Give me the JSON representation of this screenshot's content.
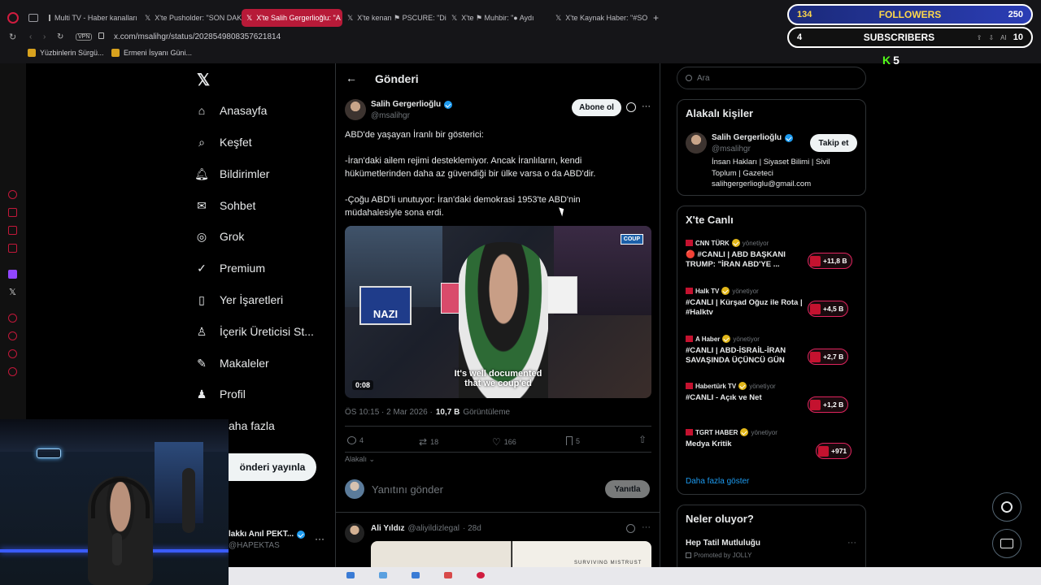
{
  "browser": {
    "tabs": [
      {
        "label": "Multi TV - Haber kanalları"
      },
      {
        "label": "X'te Pusholder: \"SON DAK"
      },
      {
        "label": "X'te Salih Gergerlioğlu: \"A"
      },
      {
        "label": "X'te kenan ⚑ PSCURE: \"Dili"
      },
      {
        "label": "X'te ⚑ Muhbir: \"● Aydı"
      },
      {
        "label": "X'te Kaynak Haber: \"#SON"
      }
    ],
    "url": "x.com/msalihgr/status/2028549808357621814",
    "vpn_label": "VPN",
    "bookmarks": [
      "Yüzbinlerin Sürgü...",
      "Ermeni İsyanı Güni..."
    ]
  },
  "stream_overlay": {
    "followers_count": "134",
    "followers_label": "FOLLOWERS",
    "followers_goal": "250",
    "subscribers_count": "4",
    "subscribers_label": "SUBSCRIBERS",
    "subscribers_goal": "10",
    "kick_count": "5",
    "ai_label": "AI"
  },
  "x": {
    "nav": [
      {
        "label": "Anasayfa",
        "icon": "home-icon"
      },
      {
        "label": "Keşfet",
        "icon": "search-icon"
      },
      {
        "label": "Bildirimler",
        "icon": "bell-icon"
      },
      {
        "label": "Sohbet",
        "icon": "mail-icon"
      },
      {
        "label": "Grok",
        "icon": "grok-icon"
      },
      {
        "label": "Premium",
        "icon": "premium-icon"
      },
      {
        "label": "Yer İşaretleri",
        "icon": "bookmark-icon"
      },
      {
        "label": "İçerik Üreticisi St...",
        "icon": "creator-icon"
      },
      {
        "label": "Makaleler",
        "icon": "article-icon"
      },
      {
        "label": "Profil",
        "icon": "profile-icon"
      },
      {
        "label": "aha fazla",
        "icon": "more-icon"
      }
    ],
    "post_button": "önderi yayınla",
    "account_name": "lakkı Anıl PEKT...",
    "account_handle": "@HAPEKTAS",
    "header_title": "Gönderi",
    "post": {
      "author": "Salih Gergerlioğlu",
      "handle": "@msalihgr",
      "follow_label": "Abone ol",
      "text_1": "ABD'de yaşayan İranlı bir gösterici:",
      "text_2": "-İran'daki ailem rejimi desteklemiyor. Ancak İranlıların, kendi hükümetlerinden daha az güvendiği bir ülke varsa o da ABD'dir.",
      "text_3": "-Çoğu ABD'li unutuyor: İran'daki demokrasi 1953'te ABD'nin müdahalesiyle sona erdi.",
      "video_caption_1": "It's well documented",
      "video_caption_2": "that we coup'ed",
      "video_duration": "0:08",
      "video_badge": "COUP",
      "meta_time": "ÖS 10:15 · 2 Mar 2026 ·",
      "meta_views": "10,7 B",
      "meta_views_label": "Görüntüleme",
      "replies": "4",
      "reposts": "18",
      "likes": "166",
      "bookmarks": "5",
      "relevance": "Alakalı"
    },
    "reply": {
      "placeholder": "Yanıtını gönder",
      "button": "Yanıtla"
    },
    "next_post": {
      "author": "Ali Yıldız",
      "handle": "@aliyildizlegal",
      "time": "· 28d",
      "image_text": "SURVIVING MISTRUST"
    },
    "search_placeholder": "Ara",
    "related": {
      "title": "Alakalı kişiler",
      "name": "Salih Gergerlioğlu",
      "handle": "@msalihgr",
      "follow": "Takip et",
      "bio_1": "İnsan Hakları | Siyaset Bilimi | Sivil",
      "bio_2": "Toplum | Gazeteci",
      "bio_3": "salihgergerlioglu@gmail.com"
    },
    "live": {
      "title": "X'te Canlı",
      "status": "yönetiyor",
      "items": [
        {
          "source": "CNN TÜRK",
          "title": "🔴 #CANLI | ABD BAŞKANI TRUMP: \"İRAN ABD'YE ...",
          "count": "+11,8 B"
        },
        {
          "source": "Halk TV",
          "title": "#CANLI | Kürşad Oğuz ile Rota | #Halktv",
          "count": "+4,5 B"
        },
        {
          "source": "A Haber",
          "title": "#CANLI | ABD-İSRAİL-İRAN SAVAŞINDA ÜÇÜNCÜ GÜN",
          "count": "+2,7 B"
        },
        {
          "source": "Habertürk TV",
          "title": "#CANLI - Açık ve Net",
          "count": "+1,2 B"
        },
        {
          "source": "TGRT HABER",
          "title": "Medya Kritik",
          "count": "+971"
        }
      ],
      "show_more": "Daha fazla göster"
    },
    "trends": {
      "title": "Neler oluyor?",
      "item": "Hep Tatil Mutluluğu",
      "promoted": "Promoted by JOLLY"
    }
  },
  "colors": {
    "accent": "#1d9bf0",
    "live": "#e0245e",
    "tab_active": "#b71a38"
  }
}
